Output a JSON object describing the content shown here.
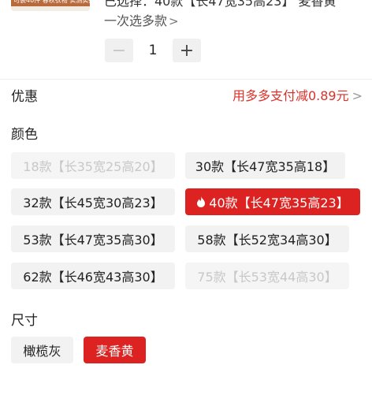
{
  "header": {
    "thumb_strip": "可装40件 春秋衣物 实测实拍",
    "top_title": "已选择：40款【长47宽35高23】 麦香黄",
    "multi_select": "一次选多款",
    "quantity": "1"
  },
  "discount": {
    "label": "优惠",
    "value": "用多多支付减0.89元"
  },
  "color": {
    "title": "颜色",
    "options": [
      {
        "label": "18款【长35宽25高20】",
        "state": "disabled"
      },
      {
        "label": "30款【长47宽35高18】",
        "state": "normal"
      },
      {
        "label": "32款【长45宽30高23】",
        "state": "normal"
      },
      {
        "label": "40款【长47宽35高23】",
        "state": "selected"
      },
      {
        "label": "53款【长47宽35高30】",
        "state": "normal"
      },
      {
        "label": "58款【长52宽34高30】",
        "state": "normal"
      },
      {
        "label": "62款【长46宽43高30】",
        "state": "normal"
      },
      {
        "label": "75款【长53宽44高30】",
        "state": "disabled"
      }
    ]
  },
  "size": {
    "title": "尺寸",
    "options": [
      {
        "label": "橄榄灰",
        "state": "normal"
      },
      {
        "label": "麦香黄",
        "state": "selected"
      }
    ]
  },
  "colors": {
    "accent_red": "#dd2222",
    "discount_red": "#d8322a",
    "chip_bg": "#f2f2f2"
  }
}
